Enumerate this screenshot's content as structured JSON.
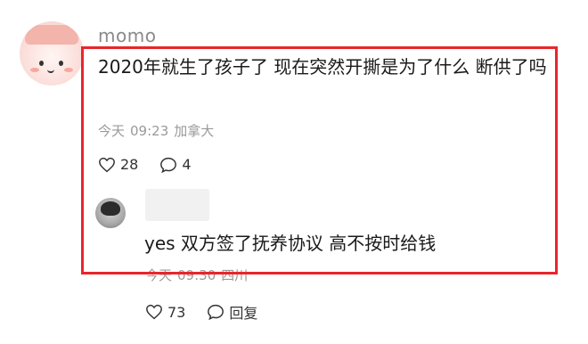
{
  "comment": {
    "username": "momo",
    "text": "2020年就生了孩子了 现在突然开撕是为了什么 断供了吗",
    "time_day": "今天",
    "time": "09:23",
    "location": "加拿大",
    "likes": "28",
    "replies": "4"
  },
  "reply": {
    "text": "yes 双方签了抚养协议 高不按时给钱",
    "time_day": "今天",
    "time": "09:30",
    "location": "四川",
    "likes": "73",
    "reply_label": "回复"
  },
  "colors": {
    "highlight": "#e8262b",
    "meta": "#9a9a9a"
  },
  "icons": [
    "heart-icon",
    "comment-bubble-icon"
  ]
}
